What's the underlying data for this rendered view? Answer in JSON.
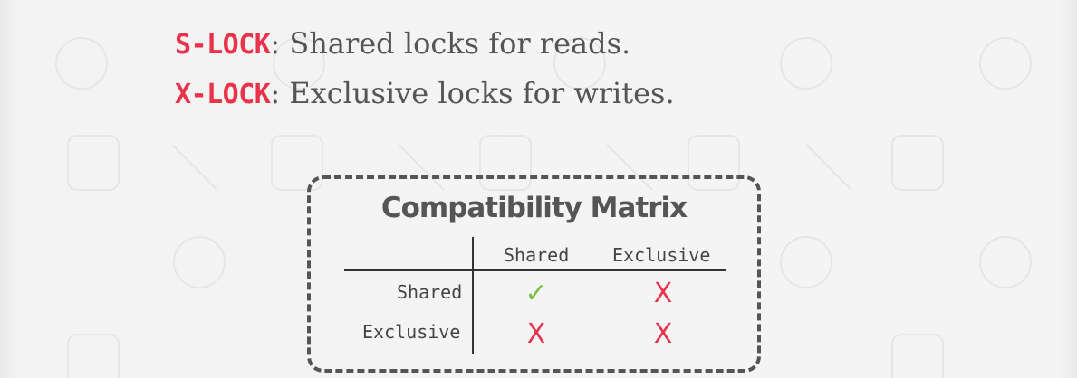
{
  "locks": {
    "shared": {
      "term": "S-LOCK",
      "description": ": Shared locks for reads."
    },
    "exclusive": {
      "term": "X-LOCK",
      "description": ": Exclusive locks for writes."
    }
  },
  "matrix": {
    "title": "Compatibility Matrix",
    "col_headers": [
      "Shared",
      "Exclusive"
    ],
    "row_headers": [
      "Shared",
      "Exclusive"
    ],
    "cells": [
      [
        "✓",
        "X"
      ],
      [
        "X",
        "X"
      ]
    ]
  },
  "colors": {
    "lock_term": "#e8334a",
    "compatible": "#7bc043",
    "incompatible": "#e8334a",
    "text": "#555555"
  }
}
